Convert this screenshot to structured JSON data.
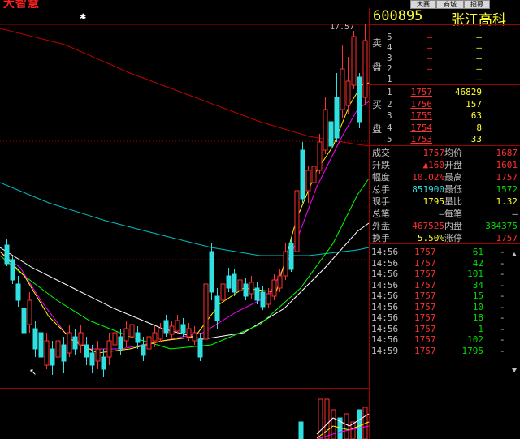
{
  "app": {
    "logo": "大智慧"
  },
  "toolbar": {
    "buttons": [
      {
        "label": "大赛"
      },
      {
        "label": "商城"
      },
      {
        "label": "招募"
      }
    ]
  },
  "chart": {
    "price_label": "17.57",
    "ma_colors": [
      "#ffffff",
      "#ff00ff",
      "#ffff00",
      "#00ff00",
      "#00c0c0",
      "#c00000"
    ]
  },
  "stock": {
    "code": "600895",
    "name": "张江高科"
  },
  "orderbook": {
    "sell_label_1": "卖",
    "sell_label_2": "盘",
    "buy_label_1": "买",
    "buy_label_2": "盘",
    "sells": [
      {
        "level": "5",
        "price": "—",
        "volume": "—"
      },
      {
        "level": "4",
        "price": "—",
        "volume": "—"
      },
      {
        "level": "3",
        "price": "—",
        "volume": "—"
      },
      {
        "level": "2",
        "price": "—",
        "volume": "—"
      },
      {
        "level": "1",
        "price": "—",
        "volume": "—"
      }
    ],
    "buys": [
      {
        "level": "1",
        "price": "1757",
        "volume": "46829"
      },
      {
        "level": "2",
        "price": "1756",
        "volume": "157"
      },
      {
        "level": "3",
        "price": "1755",
        "volume": "63"
      },
      {
        "level": "4",
        "price": "1754",
        "volume": "8"
      },
      {
        "level": "5",
        "price": "1753",
        "volume": "33"
      }
    ]
  },
  "stats": {
    "rows": [
      {
        "l1": "成交",
        "v1": "1757",
        "l2": "均价",
        "v2": "1687"
      },
      {
        "l1": "升跌",
        "v1": "▲160",
        "l2": "开盘",
        "v2": "1601"
      },
      {
        "l1": "幅度",
        "v1": "10.02%",
        "l2": "最高",
        "v2": "1757"
      },
      {
        "l1": "总手",
        "v1": "851900",
        "l2": "最低",
        "v2": "1572"
      },
      {
        "l1": "现手",
        "v1": "1795",
        "l2": "量比",
        "v2": "1.32"
      },
      {
        "l1": "总笔",
        "v1": "—",
        "l2": "每笔",
        "v2": "—"
      },
      {
        "l1": "外盘",
        "v1": "467525",
        "l2": "内盘",
        "v2": "384375"
      },
      {
        "l1": "换手",
        "v1": "5.50%",
        "l2": "涨停",
        "v2": "1757"
      }
    ]
  },
  "ticks": [
    {
      "time": "14:56",
      "price": "1757",
      "volume": "61",
      "dir": "-"
    },
    {
      "time": "14:56",
      "price": "1757",
      "volume": "42",
      "dir": "-"
    },
    {
      "time": "14:56",
      "price": "1757",
      "volume": "101",
      "dir": "-"
    },
    {
      "time": "14:56",
      "price": "1757",
      "volume": "34",
      "dir": "-"
    },
    {
      "time": "14:56",
      "price": "1757",
      "volume": "15",
      "dir": "-"
    },
    {
      "time": "14:56",
      "price": "1757",
      "volume": "10",
      "dir": "-"
    },
    {
      "time": "14:56",
      "price": "1757",
      "volume": "18",
      "dir": "-"
    },
    {
      "time": "14:56",
      "price": "1757",
      "volume": "1",
      "dir": "-"
    },
    {
      "time": "14:56",
      "price": "1757",
      "volume": "102",
      "dir": "-"
    },
    {
      "time": "14:59",
      "price": "1757",
      "volume": "1795",
      "dir": "-"
    }
  ],
  "colors": {
    "up": "#ff3030",
    "down": "#30e0e0",
    "border": "#a00000"
  }
}
